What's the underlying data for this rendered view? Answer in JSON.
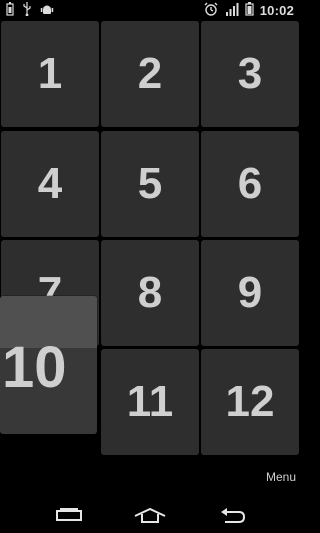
{
  "status_bar": {
    "time": "10:02",
    "left_icons": [
      "battery-icon",
      "usb-icon",
      "android-debug-icon"
    ],
    "right_icons": [
      "alarm-icon",
      "signal-icon",
      "battery-icon"
    ]
  },
  "tiles": [
    {
      "label": "1"
    },
    {
      "label": "2"
    },
    {
      "label": "3"
    },
    {
      "label": "4"
    },
    {
      "label": "5"
    },
    {
      "label": "6"
    },
    {
      "label": "7"
    },
    {
      "label": "8"
    },
    {
      "label": "9"
    },
    {
      "label": "10"
    },
    {
      "label": "11"
    },
    {
      "label": "12"
    }
  ],
  "menu_label": "Menu",
  "nav": {
    "buttons": [
      "recent-apps-icon",
      "home-icon",
      "back-icon"
    ]
  },
  "colors": {
    "background": "#000000",
    "tile": "#2e2e2e",
    "tile_text": "#cfcfcf",
    "floating_tile": "#383838"
  }
}
